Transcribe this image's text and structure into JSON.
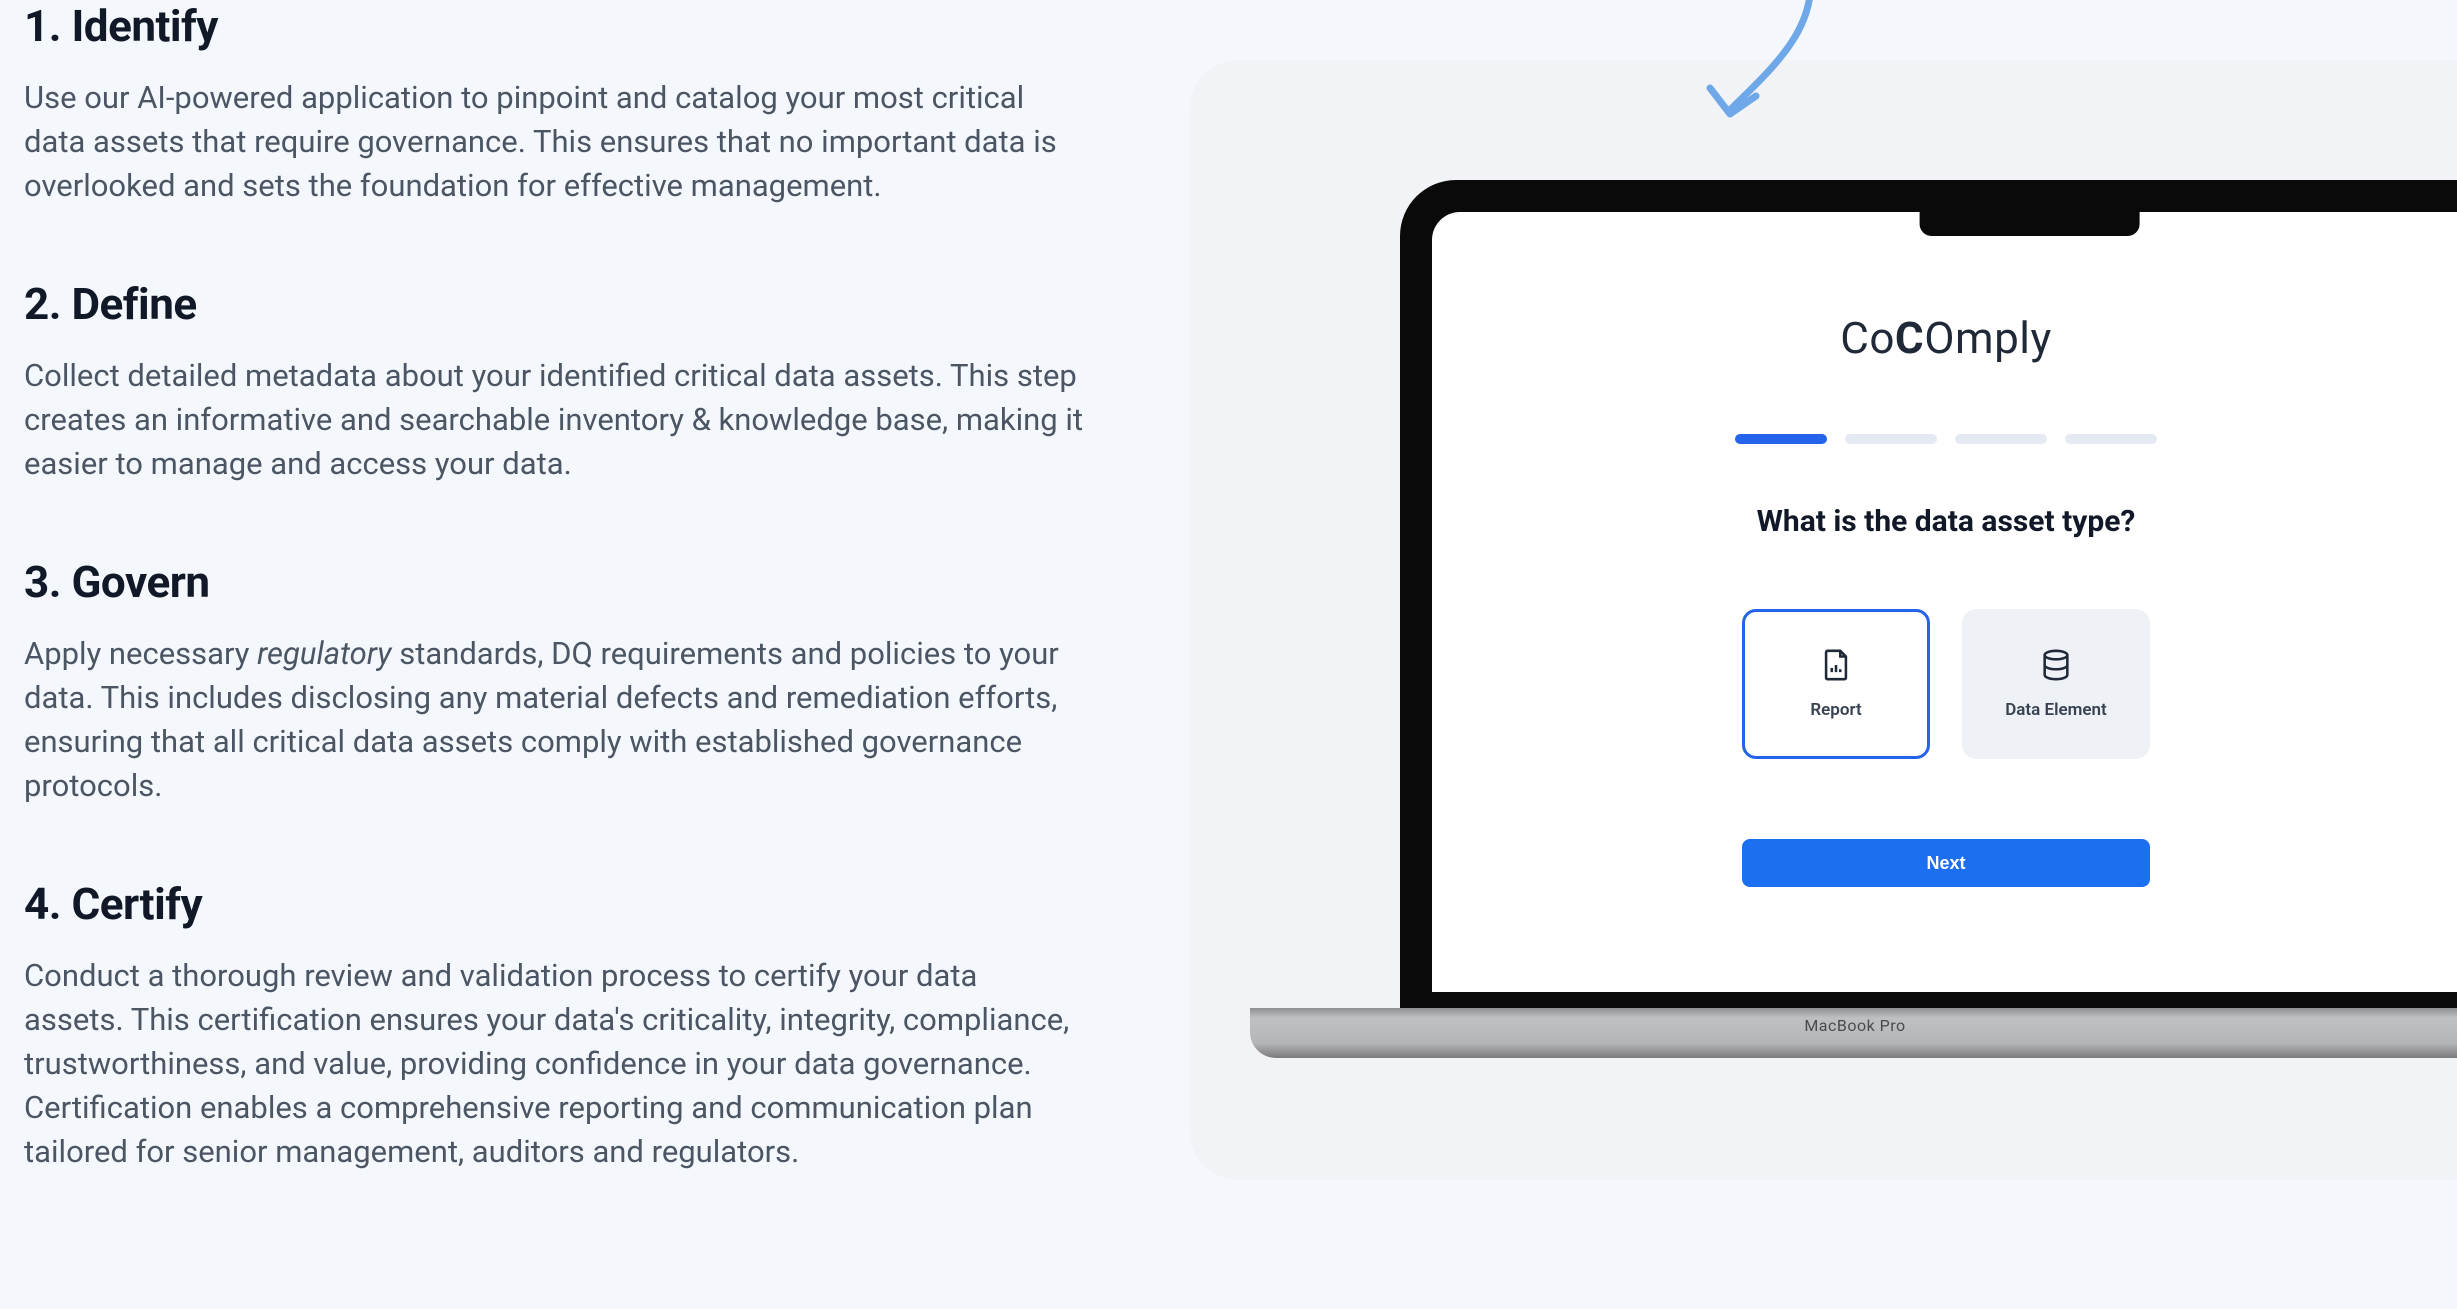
{
  "steps": [
    {
      "title": "1. Identify",
      "body": "Use our AI-powered application to pinpoint and catalog your most critical data assets that require governance. This ensures that no important data is overlooked and sets the foundation for effective management."
    },
    {
      "title": "2. Define",
      "body": "Collect detailed metadata about your identified critical data assets. This step creates an informative and searchable inventory & knowledge base, making it easier to manage and access your data."
    },
    {
      "title": "3. Govern",
      "body_pre": "Apply necessary ",
      "body_em": "regulatory",
      "body_post": " standards, DQ requirements and policies to your data. This includes disclosing any material defects and remediation efforts, ensuring that all critical data assets comply with established governance protocols."
    },
    {
      "title": "4. Certify",
      "body": "Conduct a thorough review and validation process to certify your data assets. This certification ensures your data's criticality, integrity, compliance, trustworthiness, and value, providing confidence in your data governance. Certification enables a comprehensive reporting and communication plan tailored for senior management, auditors and regulators."
    }
  ],
  "laptop": {
    "model_label": "MacBook Pro"
  },
  "app": {
    "logo_text": "CoComply",
    "question": "What is the data asset type?",
    "progress": {
      "total": 4,
      "active_index": 0
    },
    "options": [
      {
        "label": "Report",
        "selected": true,
        "icon": "document-chart-icon"
      },
      {
        "label": "Data Element",
        "selected": false,
        "icon": "database-icon"
      }
    ],
    "next_label": "Next"
  }
}
